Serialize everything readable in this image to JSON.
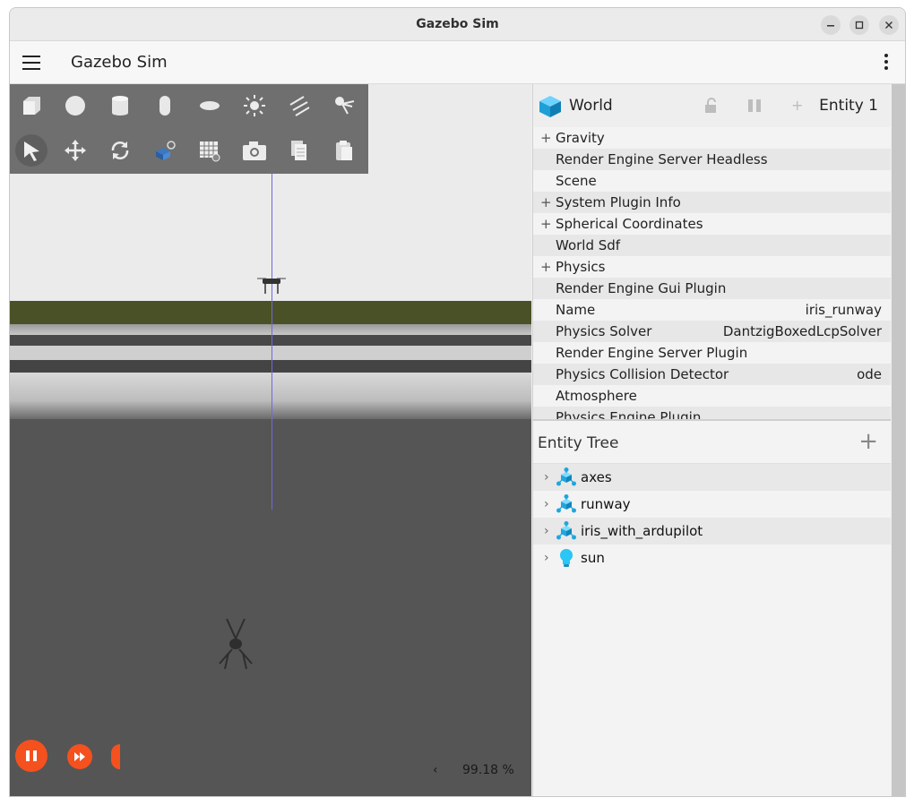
{
  "window": {
    "title": "Gazebo Sim"
  },
  "appbar": {
    "title": "Gazebo Sim"
  },
  "component_inspector": {
    "world_label": "World",
    "entity_label": "Entity 1",
    "rows": [
      {
        "label": "Gravity",
        "value": "",
        "expandable": true
      },
      {
        "label": "Render Engine Server Headless",
        "value": "",
        "expandable": false
      },
      {
        "label": "Scene",
        "value": "",
        "expandable": false
      },
      {
        "label": "System Plugin Info",
        "value": "",
        "expandable": true
      },
      {
        "label": "Spherical Coordinates",
        "value": "",
        "expandable": true
      },
      {
        "label": "World Sdf",
        "value": "",
        "expandable": false
      },
      {
        "label": "Physics",
        "value": "",
        "expandable": true
      },
      {
        "label": "Render Engine Gui Plugin",
        "value": "",
        "expandable": false
      },
      {
        "label": "Name",
        "value": "iris_runway",
        "expandable": false
      },
      {
        "label": "Physics Solver",
        "value": "DantzigBoxedLcpSolver",
        "expandable": false
      },
      {
        "label": "Render Engine Server Plugin",
        "value": "",
        "expandable": false
      },
      {
        "label": "Physics Collision Detector",
        "value": "ode",
        "expandable": false
      },
      {
        "label": "Atmosphere",
        "value": "",
        "expandable": false
      },
      {
        "label": "Physics Engine Plugin",
        "value": "",
        "expandable": false
      }
    ]
  },
  "entity_tree": {
    "title": "Entity Tree",
    "items": [
      {
        "label": "axes",
        "icon": "model-icon"
      },
      {
        "label": "runway",
        "icon": "model-icon"
      },
      {
        "label": "iris_with_ardupilot",
        "icon": "model-icon"
      },
      {
        "label": "sun",
        "icon": "light-bulb-icon"
      }
    ]
  },
  "scene": {
    "rtf": "99.18 %"
  },
  "colors": {
    "accent": "#f4511e",
    "entity_blue": "#29b6f6"
  }
}
